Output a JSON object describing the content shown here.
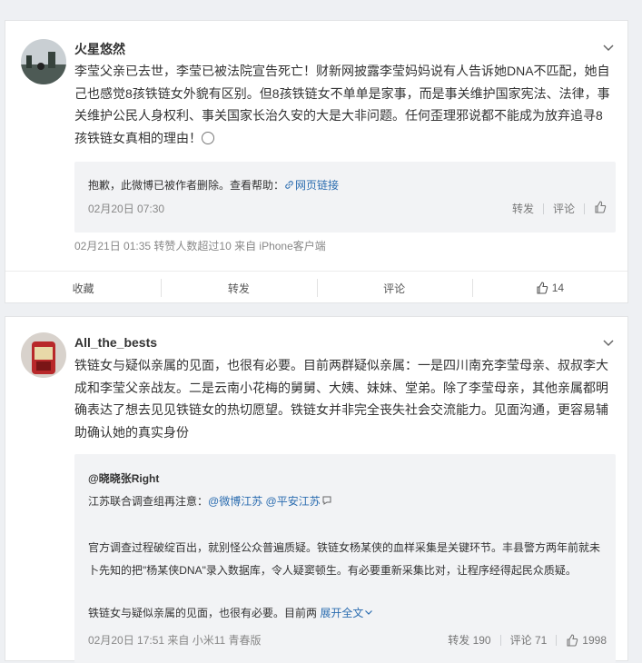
{
  "posts": [
    {
      "username": "火星悠然",
      "text": "李莹父亲已去世，李莹已被法院宣告死亡！财新网披露李莹妈妈说有人告诉她DNA不匹配，她自己也感觉8孩铁链女外貌有区别。但8孩铁链女不单单是家事，而是事关维护国家宪法、法律，事关维护公民人身权利、事关国家长治久安的大是大非问题。任何歪理邪说都不能成为放弃追寻8孩铁链女真相的理由！",
      "quote": {
        "deleted_text": "抱歉，此微博已被作者删除。查看帮助：",
        "link_label": "网页链接",
        "time": "02月20日 07:30",
        "repost": "转发",
        "comment": "评论"
      },
      "meta": "02月21日 01:35  转赞人数超过10  来自 iPhone客户端",
      "footer": {
        "favorite": "收藏",
        "repost": "转发",
        "comment": "评论",
        "likes": "14"
      }
    },
    {
      "username": "All_the_bests",
      "text": "铁链女与疑似亲属的见面，也很有必要。目前两群疑似亲属：一是四川南充李莹母亲、叔叔李大成和李莹父亲战友。二是云南小花梅的舅舅、大姨、妹妹、堂弟。除了李莹母亲，其他亲属都明确表达了想去见见铁链女的热切愿望。铁链女并非完全丧失社会交流能力。见面沟通，更容易辅助确认她的真实身份",
      "quote": {
        "author": "@晓晓张Right",
        "line1_prefix": "江苏联合调查组再注意：",
        "mention1": "@微博江苏",
        "mention2": "@平安江苏",
        "para": "官方调查过程破绽百出，就别怪公众普遍质疑。铁链女杨某侠的血样采集是关键环节。丰县警方两年前就未卜先知的把\"杨某侠DNA\"录入数据库，令人疑窦顿生。有必要重新采集比对，让程序经得起民众质疑。",
        "tail": "铁链女与疑似亲属的见面，也很有必要。目前两",
        "expand": "展开全文",
        "time": "02月20日 17:51 来自 小米11 青春版",
        "repost": "转发 190",
        "comment": "评论 71",
        "likes": "1998"
      }
    }
  ],
  "icons": [
    "chevron-down-icon",
    "link-icon",
    "thumb-up-icon",
    "smile-emoji-icon",
    "chat-icon"
  ],
  "colors": {
    "link": "#2c6db0",
    "page_bg": "#eef0f3",
    "quote_bg": "#f2f3f5"
  }
}
